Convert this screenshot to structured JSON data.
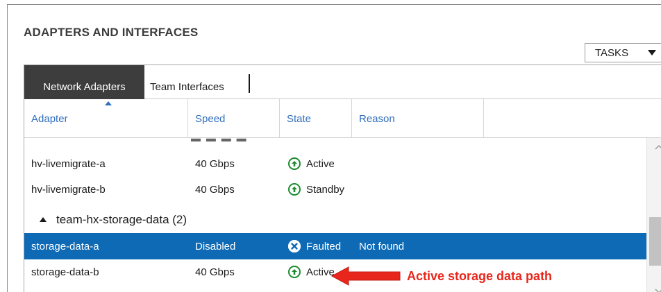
{
  "section_title": "ADAPTERS AND INTERFACES",
  "tasks_label": "TASKS",
  "tabs": {
    "active": "Network Adapters",
    "other": "Team Interfaces"
  },
  "columns": {
    "adapter": "Adapter",
    "speed": "Speed",
    "state": "State",
    "reason": "Reason"
  },
  "rows_top": [
    {
      "adapter": "hv-livemigrate-a",
      "speed": "40 Gbps",
      "state": "Active",
      "reason": ""
    },
    {
      "adapter": "hv-livemigrate-b",
      "speed": "40 Gbps",
      "state": "Standby",
      "reason": ""
    }
  ],
  "group": {
    "label": "team-hx-storage-data (2)"
  },
  "rows_group": [
    {
      "adapter": "storage-data-a",
      "speed": "Disabled",
      "state": "Faulted",
      "reason": "Not found"
    },
    {
      "adapter": "storage-data-b",
      "speed": "40 Gbps",
      "state": "Active",
      "reason": ""
    }
  ],
  "annotation": "Active storage data path",
  "colors": {
    "accent_blue": "#2f6ebd",
    "selected_row": "#0e6ab5",
    "status_green": "#1c8a2e",
    "annotation_red": "#e8261b",
    "active_tab": "#3d3d3d"
  },
  "icons": {
    "up": "status-up-icon",
    "faulted": "status-faulted-icon"
  }
}
